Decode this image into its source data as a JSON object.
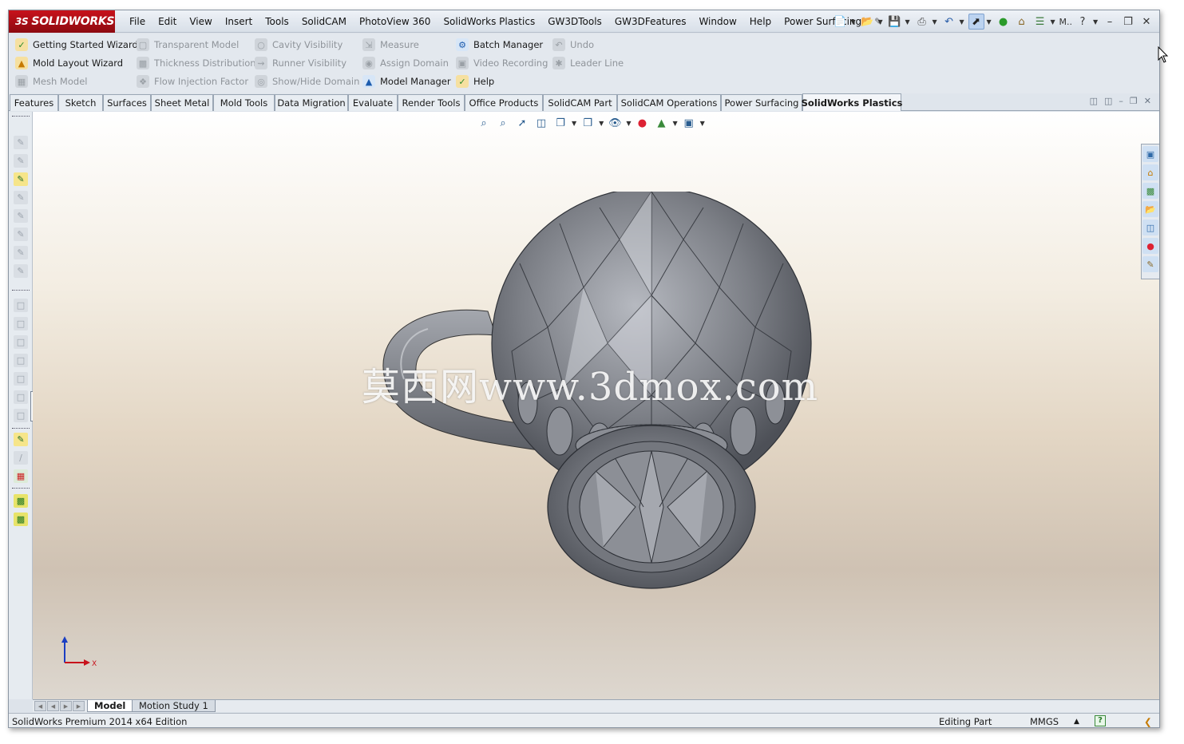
{
  "app": {
    "logo_text": "SOLIDWORKS",
    "logo_prefix": "3S"
  },
  "menu": {
    "items": [
      "File",
      "Edit",
      "View",
      "Insert",
      "Tools",
      "SolidCAM",
      "PhotoView 360",
      "SolidWorks Plastics",
      "GW3DTools",
      "GW3DFeatures",
      "Window",
      "Help",
      "Power Surfacing"
    ]
  },
  "quick_access": {
    "truncated_label": "M.."
  },
  "command_manager": {
    "col1": [
      "Getting Started Wizard",
      "Mold Layout Wizard",
      "Mesh Model"
    ],
    "col2": [
      "Transparent Model",
      "Thickness Distribution",
      "Flow Injection Factor"
    ],
    "col3": [
      "Cavity Visibility",
      "Runner Visibility",
      "Show/Hide Domain"
    ],
    "col4": [
      "Measure",
      "Assign Domain",
      "Model Manager"
    ],
    "col5": [
      "Batch Manager",
      "Video Recording",
      "Help"
    ],
    "col6": [
      "Undo",
      "Leader Line"
    ]
  },
  "tabs": [
    "Features",
    "Sketch",
    "Surfaces",
    "Sheet Metal",
    "Mold Tools",
    "Data Migration",
    "Evaluate",
    "Render Tools",
    "Office Products",
    "SolidCAM Part",
    "SolidCAM Operations",
    "Power Surfacing",
    "SolidWorks Plastics"
  ],
  "active_tab": "SolidWorks Plastics",
  "viewport": {
    "watermark": "莫西网www.3dmox.com",
    "triad_x_label": "X"
  },
  "bottom_tabs": [
    "Model",
    "Motion Study 1"
  ],
  "status": {
    "left": "SolidWorks Premium 2014 x64 Edition",
    "mode": "Editing Part",
    "units": "MMGS",
    "help_glyph": "?"
  },
  "colors": {
    "brand_red": "#c8121b",
    "accent_blue": "#1d5cae",
    "model_gray": "#7c7f86"
  }
}
